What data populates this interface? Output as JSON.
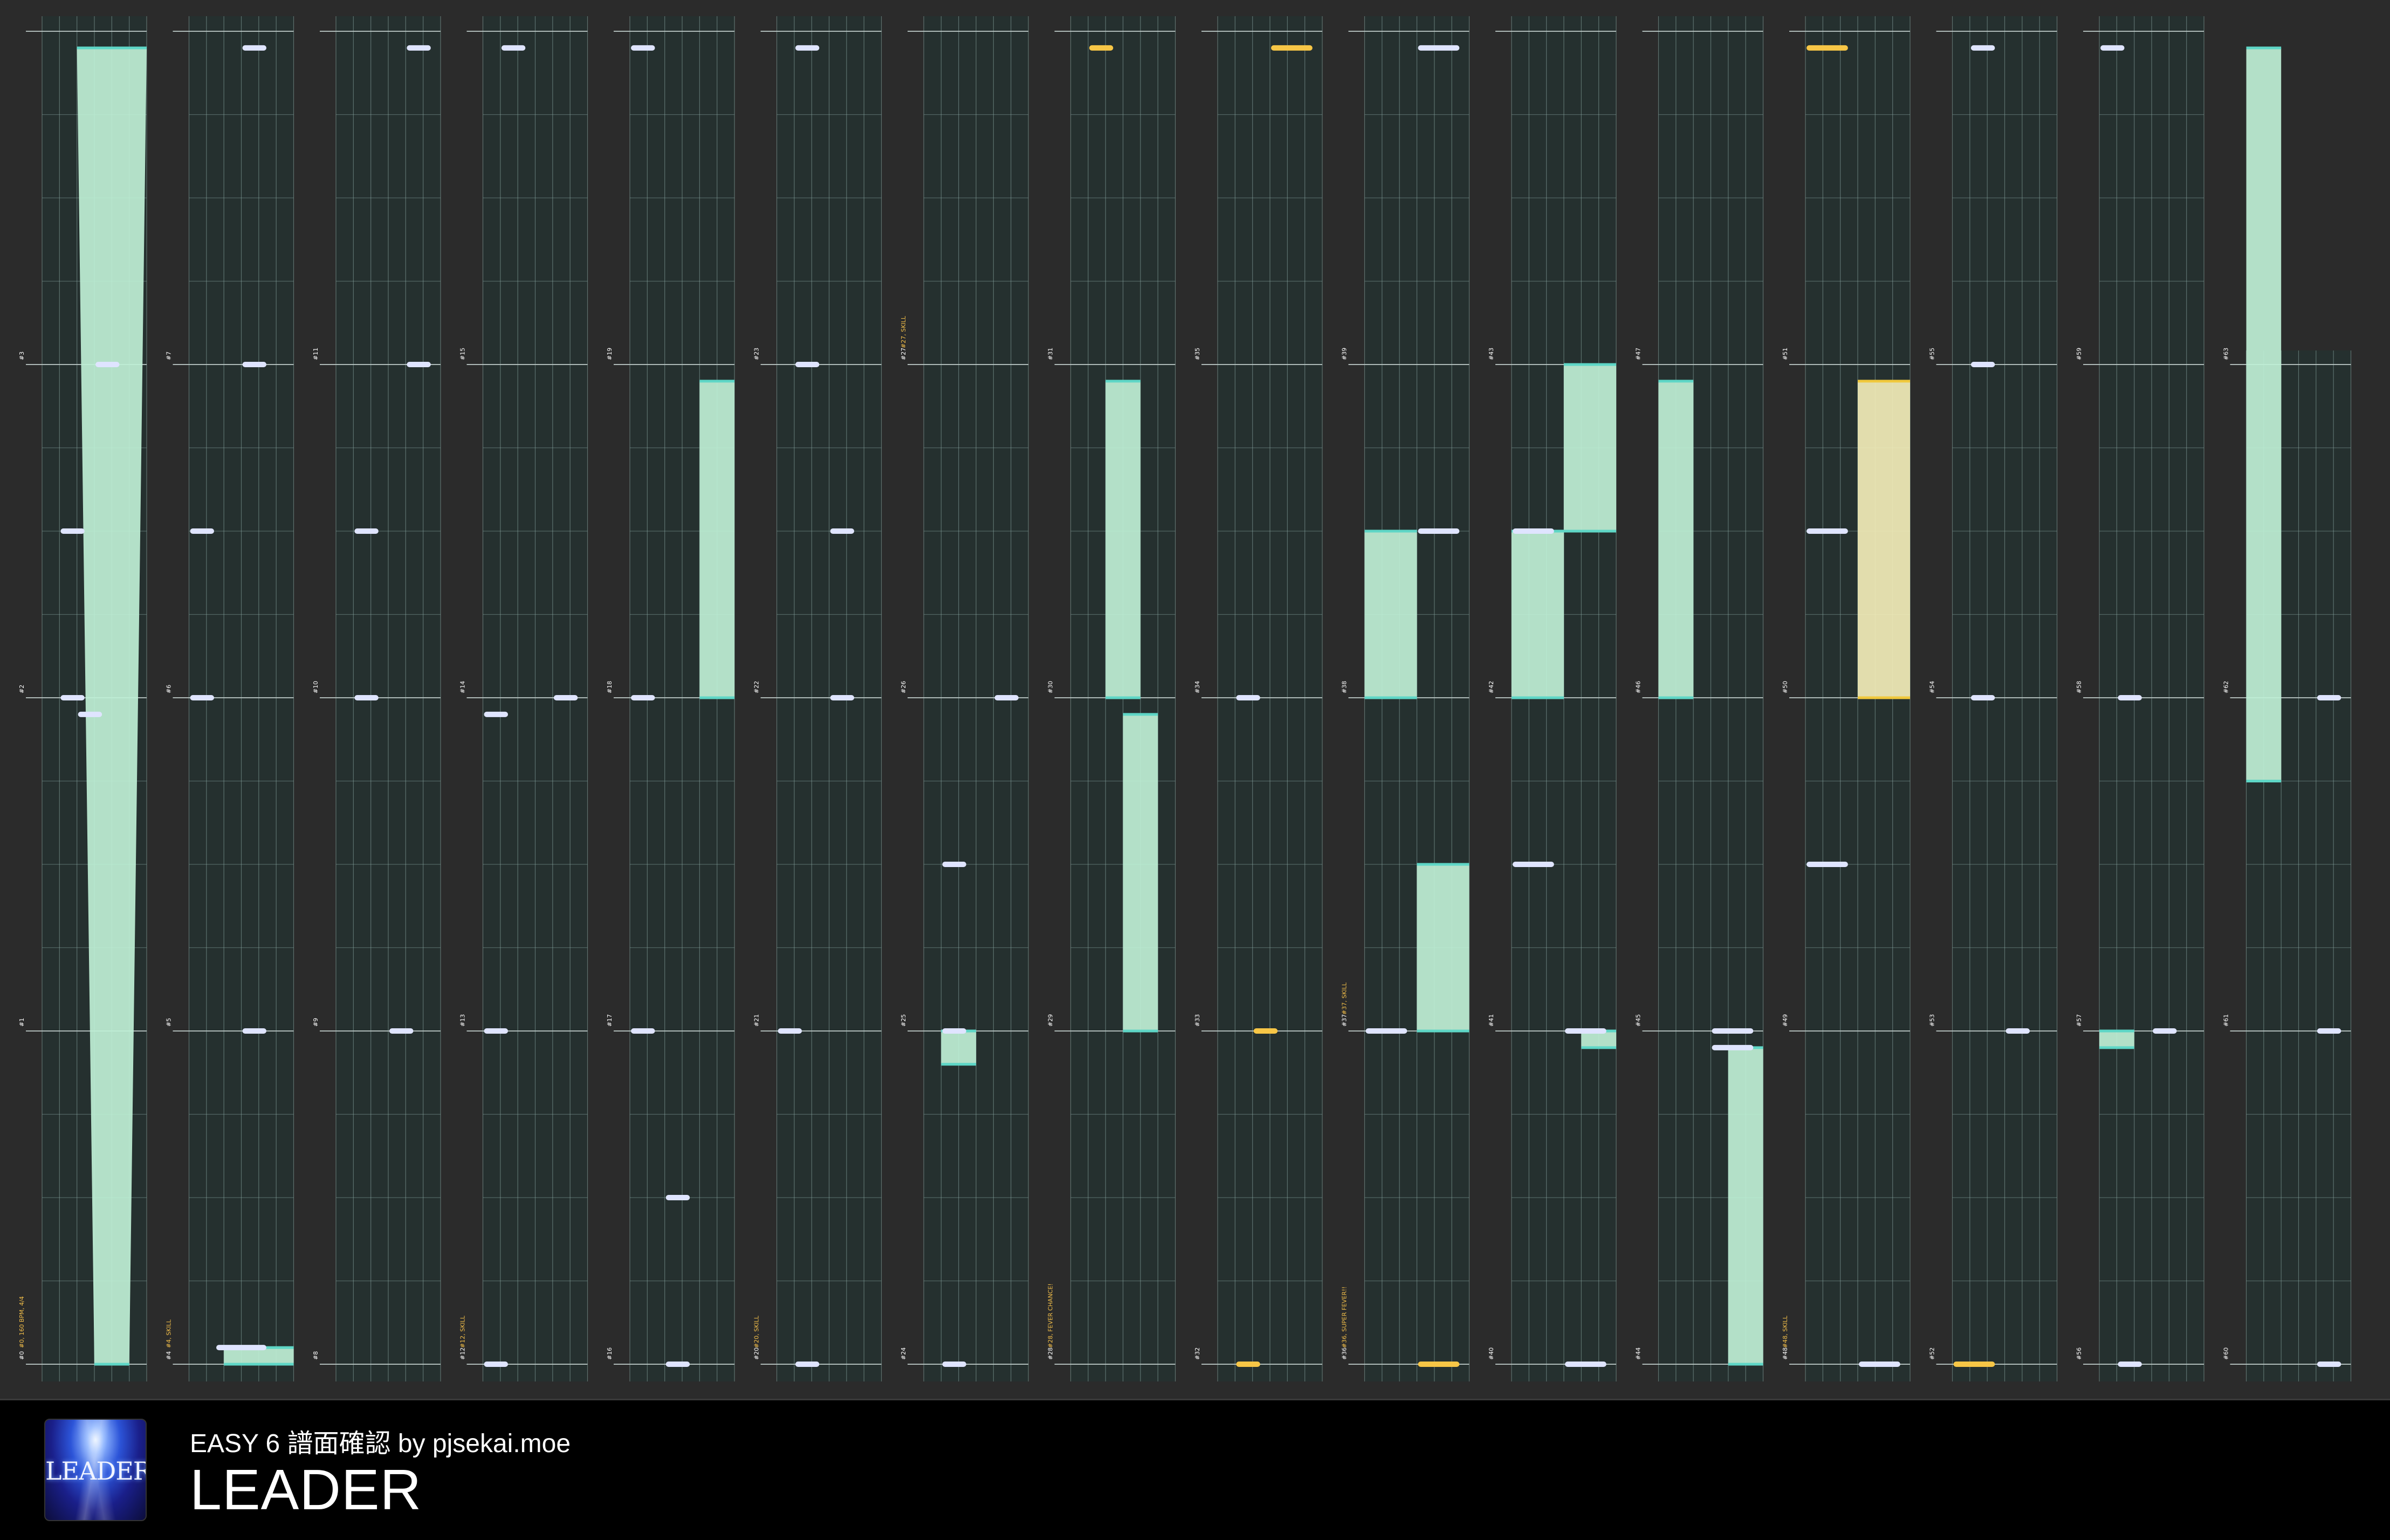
{
  "header": {
    "subtitle": "EASY 6 譜面確認 by pjsekai.moe",
    "song_title": "LEADER",
    "jacket_title": "LEADER"
  },
  "colors": {
    "background": "#2b2b2b",
    "lane_fill": "#25302f",
    "grid_line": "#8aa7a3",
    "beat_line": "#bcc9c7",
    "slide_fill": "#bff0d6",
    "slide_edge": "#5ed6c6",
    "critical_fill": "#f2edb8",
    "critical_edge": "#f0c83c",
    "tap_note": "#dfe4ff",
    "critical_note": "#f7c646",
    "measure_label": "#ffffff",
    "event_label": "#f5c04a",
    "footer_bg": "#000000"
  },
  "chart": {
    "measures_per_column": 4,
    "columns": 16,
    "last_measure": 63,
    "events": [
      {
        "measure": 0,
        "text": "#0, 160 BPM, 4/4"
      },
      {
        "measure": 4,
        "text": "#4, SKILL"
      },
      {
        "measure": 12,
        "text": "#12, SKILL"
      },
      {
        "measure": 20,
        "text": "#20, SKILL"
      },
      {
        "measure": 27,
        "text": "#27, SKILL"
      },
      {
        "measure": 28,
        "text": "#28, FEVER CHANCE!"
      },
      {
        "measure": 36,
        "text": "#36, SUPER FEVER!!"
      },
      {
        "measure": 37,
        "text": "#37, SKILL"
      },
      {
        "measure": 48,
        "text": "#48, SKILL"
      }
    ],
    "notes": [
      {
        "m": 1,
        "p": 0.95,
        "l": 4,
        "w": 3
      },
      {
        "m": 2,
        "p": 0.0,
        "l": 2,
        "w": 3
      },
      {
        "m": 2,
        "p": 0.5,
        "l": 2,
        "w": 3
      },
      {
        "m": 3,
        "p": 0.0,
        "l": 6,
        "w": 3
      },
      {
        "m": 4,
        "p": 0.05,
        "l": 3,
        "w": 6
      },
      {
        "m": 5,
        "p": 0.0,
        "l": 6,
        "w": 3
      },
      {
        "m": 6,
        "p": 0.0,
        "l": 0,
        "w": 3
      },
      {
        "m": 6,
        "p": 0.5,
        "l": 0,
        "w": 3
      },
      {
        "m": 7,
        "p": 0.0,
        "l": 6,
        "w": 3
      },
      {
        "m": 7,
        "p": 0.95,
        "l": 6,
        "w": 3
      },
      {
        "m": 9,
        "p": 0.0,
        "l": 6,
        "w": 3
      },
      {
        "m": 10,
        "p": 0.0,
        "l": 2,
        "w": 3
      },
      {
        "m": 10,
        "p": 0.5,
        "l": 2,
        "w": 3
      },
      {
        "m": 11,
        "p": 0.0,
        "l": 8,
        "w": 3
      },
      {
        "m": 11,
        "p": 0.95,
        "l": 8,
        "w": 3
      },
      {
        "m": 12,
        "p": 0.0,
        "l": 0,
        "w": 3
      },
      {
        "m": 13,
        "p": 0.0,
        "l": 0,
        "w": 3
      },
      {
        "m": 13,
        "p": 0.95,
        "l": 0,
        "w": 3
      },
      {
        "m": 14,
        "p": 0.0,
        "l": 8,
        "w": 3
      },
      {
        "m": 15,
        "p": 0.95,
        "l": 2,
        "w": 3
      },
      {
        "m": 16,
        "p": 0.0,
        "l": 4,
        "w": 3
      },
      {
        "m": 16,
        "p": 0.5,
        "l": 4,
        "w": 3
      },
      {
        "m": 17,
        "p": 0.0,
        "l": 0,
        "w": 3
      },
      {
        "m": 18,
        "p": 0.0,
        "l": 0,
        "w": 3
      },
      {
        "m": 19,
        "p": 0.95,
        "l": 0,
        "w": 3
      },
      {
        "m": 20,
        "p": 0.0,
        "l": 2,
        "w": 3
      },
      {
        "m": 21,
        "p": 0.0,
        "l": 0,
        "w": 3
      },
      {
        "m": 22,
        "p": 0.0,
        "l": 6,
        "w": 3
      },
      {
        "m": 22,
        "p": 0.5,
        "l": 6,
        "w": 3
      },
      {
        "m": 23,
        "p": 0.0,
        "l": 2,
        "w": 3
      },
      {
        "m": 23,
        "p": 0.95,
        "l": 2,
        "w": 3
      },
      {
        "m": 24,
        "p": 0.0,
        "l": 2,
        "w": 3
      },
      {
        "m": 25,
        "p": 0.0,
        "l": 2,
        "w": 3
      },
      {
        "m": 25,
        "p": 0.5,
        "l": 2,
        "w": 3
      },
      {
        "m": 26,
        "p": 0.0,
        "l": 8,
        "w": 3
      },
      {
        "m": 31,
        "p": 0.95,
        "l": 2,
        "w": 3,
        "c": true
      },
      {
        "m": 32,
        "p": 0.0,
        "l": 2,
        "w": 3,
        "c": true
      },
      {
        "m": 33,
        "p": 0.0,
        "l": 4,
        "w": 3,
        "c": true
      },
      {
        "m": 34,
        "p": 0.0,
        "l": 2,
        "w": 3
      },
      {
        "m": 35,
        "p": 0.95,
        "l": 6,
        "w": 5,
        "c": true
      },
      {
        "m": 36,
        "p": 0.0,
        "l": 6,
        "w": 5,
        "c": true
      },
      {
        "m": 37,
        "p": 0.0,
        "l": 0,
        "w": 5
      },
      {
        "m": 38,
        "p": 0.5,
        "l": 6,
        "w": 5
      },
      {
        "m": 39,
        "p": 0.95,
        "l": 6,
        "w": 5
      },
      {
        "m": 40,
        "p": 0.0,
        "l": 6,
        "w": 5
      },
      {
        "m": 41,
        "p": 0.0,
        "l": 6,
        "w": 5
      },
      {
        "m": 41,
        "p": 0.5,
        "l": 0,
        "w": 5
      },
      {
        "m": 42,
        "p": 0.5,
        "l": 0,
        "w": 5
      },
      {
        "m": 44,
        "p": 0.95,
        "l": 6,
        "w": 5
      },
      {
        "m": 45,
        "p": 0.0,
        "l": 6,
        "w": 5
      },
      {
        "m": 48,
        "p": 0.0,
        "l": 6,
        "w": 5
      },
      {
        "m": 49,
        "p": 0.5,
        "l": 0,
        "w": 5
      },
      {
        "m": 50,
        "p": 0.5,
        "l": 0,
        "w": 5
      },
      {
        "m": 51,
        "p": 0.95,
        "l": 0,
        "w": 5,
        "c": true
      },
      {
        "m": 52,
        "p": 0.0,
        "l": 0,
        "w": 5,
        "c": true
      },
      {
        "m": 53,
        "p": 0.0,
        "l": 6,
        "w": 3
      },
      {
        "m": 54,
        "p": 0.0,
        "l": 2,
        "w": 3
      },
      {
        "m": 55,
        "p": 0.0,
        "l": 2,
        "w": 3
      },
      {
        "m": 55,
        "p": 0.95,
        "l": 2,
        "w": 3
      },
      {
        "m": 56,
        "p": 0.0,
        "l": 2,
        "w": 3
      },
      {
        "m": 57,
        "p": 0.0,
        "l": 6,
        "w": 3
      },
      {
        "m": 58,
        "p": 0.0,
        "l": 2,
        "w": 3
      },
      {
        "m": 59,
        "p": 0.95,
        "l": 0,
        "w": 3
      },
      {
        "m": 60,
        "p": 0.0,
        "l": 8,
        "w": 3
      },
      {
        "m": 61,
        "p": 0.0,
        "l": 8,
        "w": 3
      },
      {
        "m": 62,
        "p": 0.0,
        "l": 8,
        "w": 3
      }
    ],
    "holds": [
      {
        "sm": 0,
        "sp": 0.0,
        "sl": 6,
        "sw": 4,
        "em": 3,
        "ep": 0.95,
        "el": 4,
        "ew": 8
      },
      {
        "sm": 4,
        "sp": 0.0,
        "sl": 4,
        "sw": 8,
        "em": 4,
        "ep": 0.05,
        "el": 4,
        "ew": 8
      },
      {
        "sm": 10,
        "sp": 0.0,
        "sl": 0,
        "sw": 0,
        "em": 8,
        "ep": 0.0,
        "el": 0,
        "ew": 0
      },
      {
        "sm": 18,
        "sp": 0.0,
        "sl": 8,
        "sw": 4,
        "em": 18,
        "ep": 0.95,
        "el": 8,
        "ew": 4
      },
      {
        "sm": 24,
        "sp": 0.9,
        "sl": 2,
        "sw": 4,
        "em": 24,
        "ep": 1.0,
        "el": 2,
        "ew": 4
      },
      {
        "sm": 29,
        "sp": 0.0,
        "sl": 6,
        "sw": 4,
        "em": 29,
        "ep": 0.95,
        "el": 6,
        "ew": 4
      },
      {
        "sm": 30,
        "sp": 0.0,
        "sl": 4,
        "sw": 4,
        "em": 30,
        "ep": 0.95,
        "el": 4,
        "ew": 4
      },
      {
        "sm": 38,
        "sp": 0.0,
        "sl": 0,
        "sw": 6,
        "em": 38,
        "ep": 0.5,
        "el": 0,
        "ew": 6
      },
      {
        "sm": 37,
        "sp": 0.0,
        "sl": 6,
        "sw": 6,
        "em": 37,
        "ep": 0.5,
        "el": 6,
        "ew": 6
      },
      {
        "sm": 40,
        "sp": 0.95,
        "sl": 8,
        "sw": 4,
        "em": 40,
        "ep": 1.0,
        "el": 8,
        "ew": 4
      },
      {
        "sm": 42,
        "sp": 0.0,
        "sl": 0,
        "sw": 6,
        "em": 42,
        "ep": 0.5,
        "el": 0,
        "ew": 6
      },
      {
        "sm": 42,
        "sp": 0.5,
        "sl": 6,
        "sw": 6,
        "em": 42,
        "ep": 1.0,
        "el": 6,
        "ew": 6
      },
      {
        "sm": 44,
        "sp": 0.0,
        "sl": 8,
        "sw": 4,
        "em": 44,
        "ep": 0.95,
        "el": 8,
        "ew": 4
      },
      {
        "sm": 46,
        "sp": 0.0,
        "sl": 0,
        "sw": 4,
        "em": 46,
        "ep": 0.95,
        "el": 0,
        "ew": 4
      },
      {
        "sm": 50,
        "sp": 0.0,
        "sl": 6,
        "sw": 6,
        "em": 50,
        "ep": 0.95,
        "el": 6,
        "ew": 6,
        "c": true
      },
      {
        "sm": 56,
        "sp": 0.95,
        "sl": 0,
        "sw": 4,
        "em": 56,
        "ep": 1.0,
        "el": 0,
        "ew": 4
      },
      {
        "sm": 61,
        "sp": 0.75,
        "sl": 0,
        "sw": 4,
        "em": 63,
        "ep": 0.95,
        "el": 0,
        "ew": 4
      }
    ]
  }
}
